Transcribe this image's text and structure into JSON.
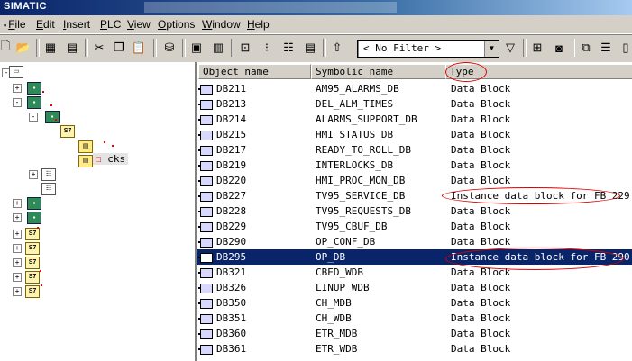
{
  "window": {
    "title": "SIMATIC"
  },
  "menu": [
    {
      "label": "File",
      "u": "F",
      "rest": "ile"
    },
    {
      "label": "Edit",
      "u": "E",
      "rest": "dit"
    },
    {
      "label": "Insert",
      "u": "I",
      "rest": "nsert"
    },
    {
      "label": "PLC",
      "u": "P",
      "rest": "LC"
    },
    {
      "label": "View",
      "u": "V",
      "rest": "iew"
    },
    {
      "label": "Options",
      "u": "O",
      "rest": "ptions"
    },
    {
      "label": "Window",
      "u": "W",
      "rest": "indow"
    },
    {
      "label": "Help",
      "u": "H",
      "rest": "elp"
    }
  ],
  "toolbar": {
    "filter_value": "< No Filter >"
  },
  "tree": {
    "selected_label": "cks",
    "badge": "S7"
  },
  "columns": {
    "object_name": "Object name",
    "symbolic_name": "Symbolic name",
    "type": "Type"
  },
  "rows": [
    {
      "name": "DB211",
      "symbol": "AM95_ALARMS_DB",
      "type": "Data Block"
    },
    {
      "name": "DB213",
      "symbol": "DEL_ALM_TIMES",
      "type": "Data Block"
    },
    {
      "name": "DB214",
      "symbol": "ALARMS_SUPPORT_DB",
      "type": "Data Block"
    },
    {
      "name": "DB215",
      "symbol": "HMI_STATUS_DB",
      "type": "Data Block"
    },
    {
      "name": "DB217",
      "symbol": "READY_TO_ROLL_DB",
      "type": "Data Block"
    },
    {
      "name": "DB219",
      "symbol": "INTERLOCKS_DB",
      "type": "Data Block"
    },
    {
      "name": "DB220",
      "symbol": "HMI_PROC_MON_DB",
      "type": "Data Block"
    },
    {
      "name": "DB227",
      "symbol": "TV95_SERVICE_DB",
      "type": "Instance data block for FB 229"
    },
    {
      "name": "DB228",
      "symbol": "TV95_REQUESTS_DB",
      "type": "Data Block"
    },
    {
      "name": "DB229",
      "symbol": "TV95_CBUF_DB",
      "type": "Data Block"
    },
    {
      "name": "DB290",
      "symbol": "OP_CONF_DB",
      "type": "Data Block"
    },
    {
      "name": "DB295",
      "symbol": "OP_DB",
      "type": "Instance data block for FB 290"
    },
    {
      "name": "DB321",
      "symbol": "CBED_WDB",
      "type": "Data Block"
    },
    {
      "name": "DB326",
      "symbol": "LINUP_WDB",
      "type": "Data Block"
    },
    {
      "name": "DB350",
      "symbol": "CH_MDB",
      "type": "Data Block"
    },
    {
      "name": "DB351",
      "symbol": "CH_WDB",
      "type": "Data Block"
    },
    {
      "name": "DB360",
      "symbol": "ETR_MDB",
      "type": "Data Block"
    },
    {
      "name": "DB361",
      "symbol": "ETR_WDB",
      "type": "Data Block"
    }
  ],
  "selected_row": "DB295",
  "colors": {
    "selection": "#0a246a",
    "annotation": "#e00000"
  }
}
